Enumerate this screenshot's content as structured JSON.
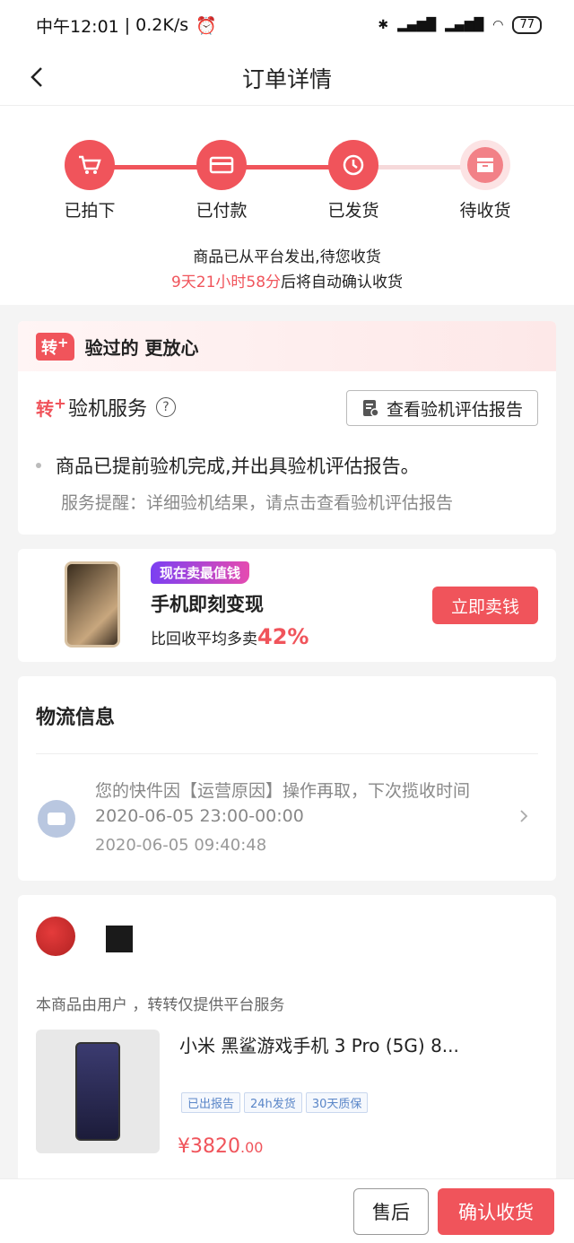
{
  "status_bar": {
    "time": "中午12:01",
    "speed": "0.2K/s",
    "battery": "77"
  },
  "nav": {
    "title": "订单详情"
  },
  "progress": {
    "steps": [
      {
        "label": "已拍下",
        "icon": "cart-icon",
        "done": true
      },
      {
        "label": "已付款",
        "icon": "card-icon",
        "done": true
      },
      {
        "label": "已发货",
        "icon": "shipping-icon",
        "done": true
      },
      {
        "label": "待收货",
        "icon": "box-icon",
        "done": false
      }
    ],
    "message_line1": "商品已从平台发出,待您收货",
    "countdown": "9天21小时58分",
    "message_line2_suffix": "后将自动确认收货"
  },
  "inspection": {
    "badge": "转",
    "header_text": "验过的 更放心",
    "service_badge": "转",
    "service_title": "验机服务",
    "help_symbol": "?",
    "report_button": "查看验机评估报告",
    "bullet": "商品已提前验机完成,并出具验机评估报告。",
    "reminder": "服务提醒：详细验机结果，请点击查看验机评估报告"
  },
  "sell_banner": {
    "tag": "现在卖最值钱",
    "title": "手机即刻变现",
    "subtitle": "比回收平均多卖",
    "percent": "42%",
    "button": "立即卖钱"
  },
  "logistics": {
    "title": "物流信息",
    "text": "您的快件因【运营原因】操作再取，下次揽收时间2020-06-05 23:00-00:00",
    "time": "2020-06-05 09:40:48"
  },
  "product": {
    "note": "本商品由用户                 ，转转仅提供平台服务",
    "title": "小米 黑鲨游戏手机 3 Pro (5G) 8...",
    "tags": [
      "已出报告",
      "24h发货",
      "30天质保"
    ],
    "price_int": "¥3820",
    "price_dec": ".00"
  },
  "bottom": {
    "after_sale": "售后",
    "confirm": "确认收货"
  },
  "colors": {
    "accent": "#f0545b",
    "tag_blue": "#5a86c8"
  }
}
